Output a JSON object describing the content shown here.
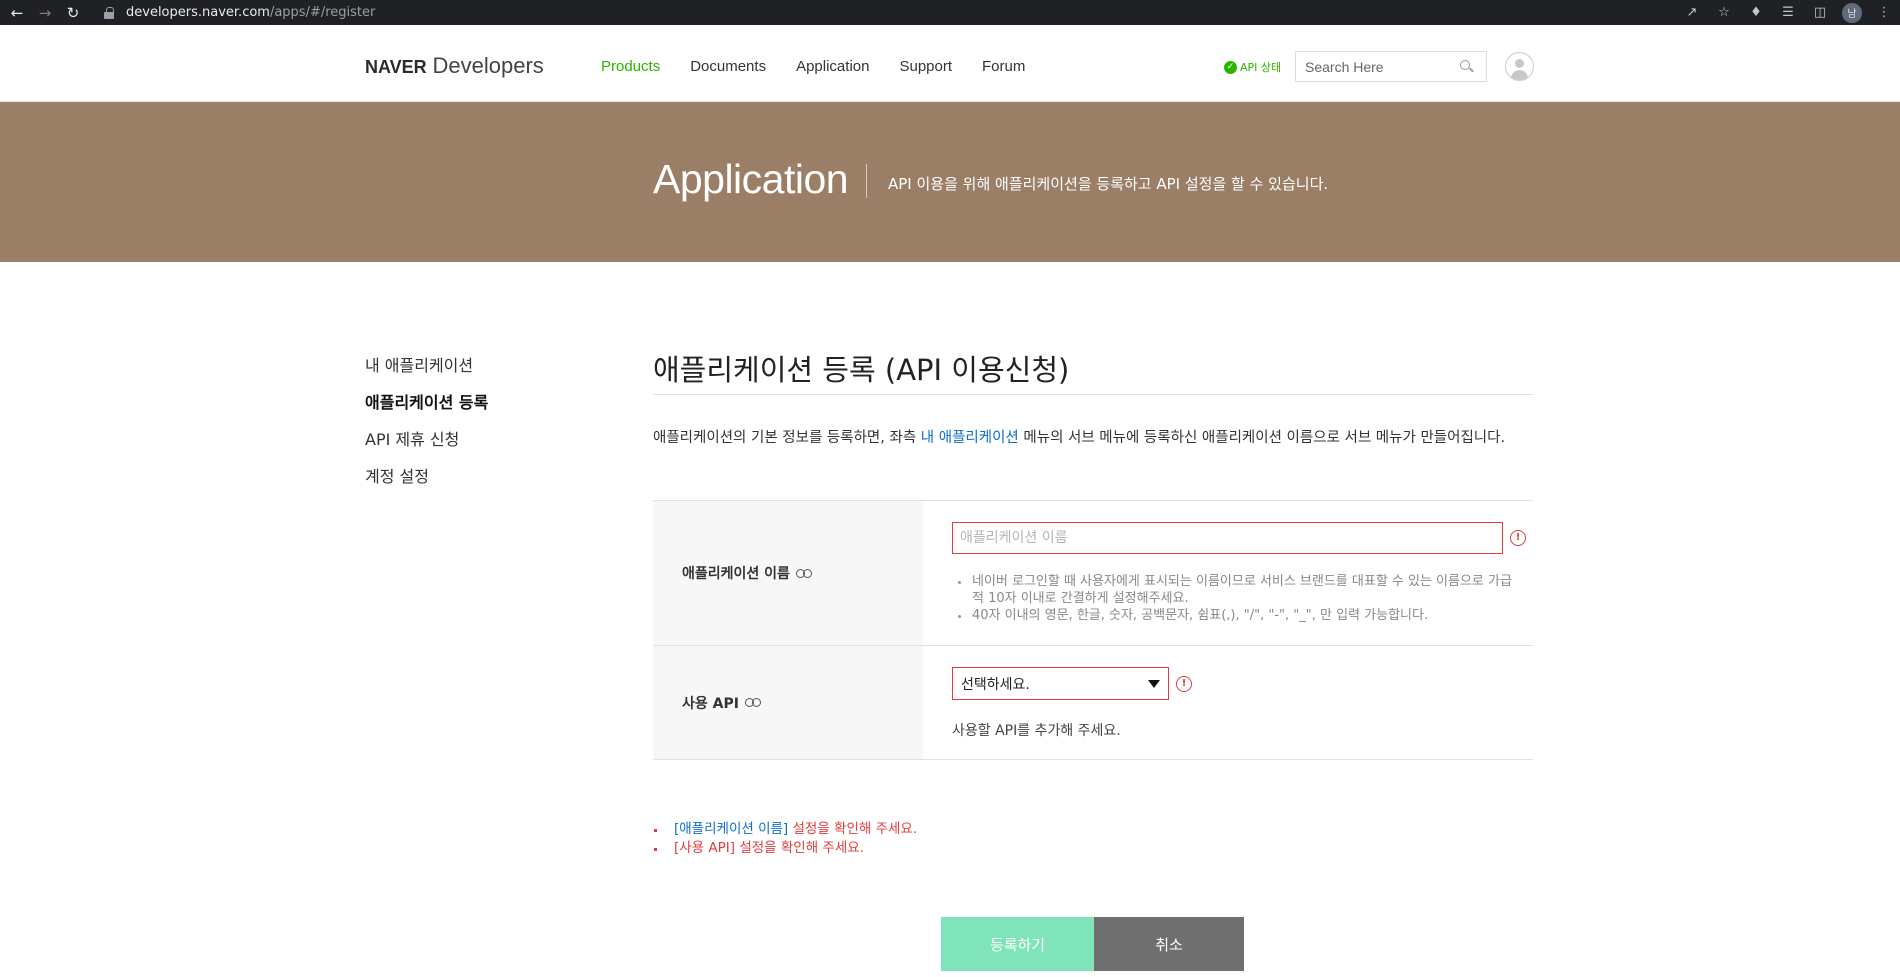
{
  "browser": {
    "url_host": "developers.naver.com",
    "url_path": "/apps/#/register",
    "profile_initial": "남"
  },
  "header": {
    "logo_naver": "NAVER",
    "logo_dev": "Developers",
    "nav": [
      "Products",
      "Documents",
      "Application",
      "Support",
      "Forum"
    ],
    "active_nav": "Products",
    "api_status": "API 상태",
    "search_placeholder": "Search Here"
  },
  "banner": {
    "title": "Application",
    "description": "API 이용을 위해 애플리케이션을 등록하고 API 설정을 할 수 있습니다."
  },
  "sidebar": {
    "items": [
      "내 애플리케이션",
      "애플리케이션 등록",
      "API 제휴 신청",
      "계정 설정"
    ],
    "current": "애플리케이션 등록"
  },
  "main": {
    "title": "애플리케이션 등록 (API 이용신청)",
    "intro_before": "애플리케이션의 기본 정보를 등록하면, 좌측 ",
    "intro_link": "내 애플리케이션",
    "intro_after": " 메뉴의 서브 메뉴에 등록하신 애플리케이션 이름으로 서브 메뉴가 만들어집니다.",
    "form": {
      "app_name_label": "애플리케이션 이름",
      "app_name_placeholder": "애플리케이션 이름",
      "app_name_value": "",
      "guide": [
        "네이버 로그인할 때 사용자에게 표시되는 이름이므로 서비스 브랜드를 대표할 수 있는 이름으로 가급적 10자 이내로 간결하게 설정해주세요.",
        "40자 이내의 영문, 한글, 숫자, 공백문자, 쉼표(,), \"/\", \"-\", \"_\", 만 입력 가능합니다."
      ],
      "api_label": "사용 API",
      "api_select_value": "선택하세요.",
      "api_help": "사용할 API를 추가해 주세요."
    },
    "errors": [
      {
        "field": "[애플리케이션 이름]",
        "message": " 설정을 확인해 주세요."
      },
      {
        "field": "[사용 API]",
        "message": " 설정을 확인해 주세요."
      }
    ],
    "buttons": {
      "register": "등록하기",
      "cancel": "취소"
    }
  },
  "colors": {
    "brand_green": "#2db400",
    "banner_bg": "#9a7e66",
    "error_red": "#e23c3c",
    "link_blue": "#0f6dc9",
    "register_btn": "#7fe4b9",
    "cancel_btn": "#6f6f6f"
  }
}
